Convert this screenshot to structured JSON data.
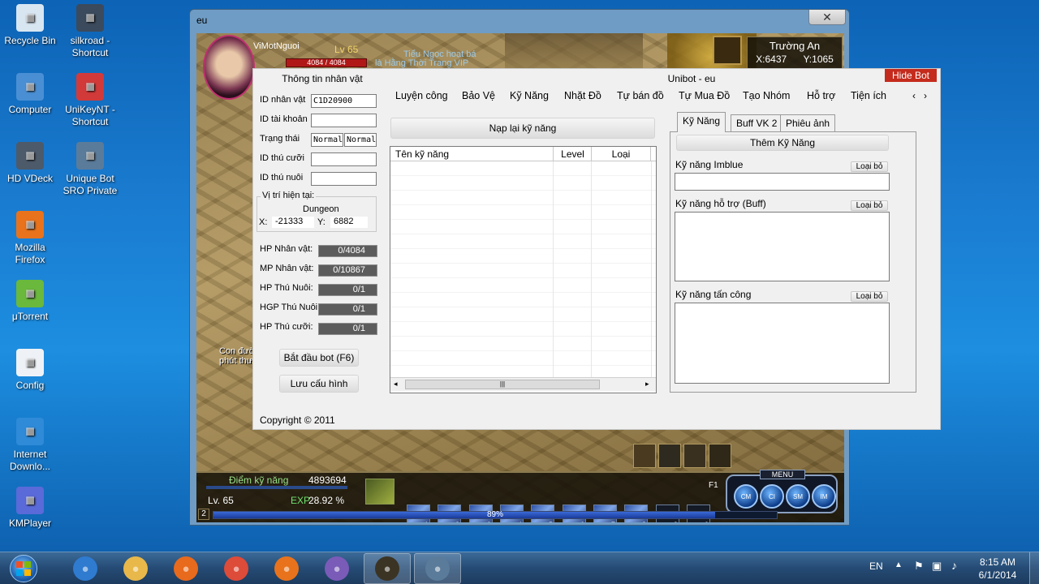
{
  "desktop": {
    "icons": [
      {
        "label": "Recycle Bin",
        "icon": "recycle-bin-icon",
        "color": "#d8e6f2"
      },
      {
        "label": "silkroad - Shortcut",
        "icon": "silkroad-icon",
        "color": "#3b4a5c"
      },
      {
        "label": "Computer",
        "icon": "computer-icon",
        "color": "#4a8fd4"
      },
      {
        "label": "UniKeyNT - Shortcut",
        "icon": "unikey-icon",
        "color": "#d23a3a"
      },
      {
        "label": "HD VDeck",
        "icon": "hd-vdeck-icon",
        "color": "#4d5a6a"
      },
      {
        "label": "Unique Bot SRO Private",
        "icon": "unique-bot-icon",
        "color": "#5b7b9a"
      },
      {
        "label": "Mozilla Firefox",
        "icon": "firefox-icon",
        "color": "#e8731c"
      },
      {
        "label": "μTorrent",
        "icon": "utorrent-icon",
        "color": "#6ab83c"
      },
      {
        "label": "Config",
        "icon": "config-icon",
        "color": "#eef2f6"
      },
      {
        "label": "Internet Downlo...",
        "icon": "idm-icon",
        "color": "#2f8ad8"
      },
      {
        "label": "KMPlayer",
        "icon": "kmplayer-icon",
        "color": "#5a6ad8"
      }
    ]
  },
  "game_window": {
    "title": "eu",
    "close_label": "✕",
    "character_name": "ViMotNguoi",
    "level": "Lv 65",
    "hp": "4084 / 4084",
    "banner_1": "Tiểu Ngọc hoạt bá",
    "banner_2": "là Hằng Thời Trang VIP",
    "location_title": "Trường An",
    "coord_x": "X:6437",
    "coord_y": "Y:1065",
    "chat_text": "Con đườ có k con cổ g khắc thư đượ những giờ phút thư giãn tuyệt vời!",
    "skill_points_label": "Điểm kỹ năng",
    "skill_points_value": "4893694",
    "level_bottom": "Lv. 65",
    "exp_label": "EXP",
    "exp_value": "28.92 %",
    "hud_progress_text": "89%",
    "hud_progress": 0.89,
    "menu_label": "MENU",
    "page_num": "2",
    "f1": "F1",
    "skill_slots": [
      "1",
      "2",
      "3",
      "4",
      "5",
      "6",
      "7",
      "8",
      "9",
      "0"
    ],
    "orbs": [
      "CM",
      "CI",
      "SM",
      "IM"
    ]
  },
  "bot": {
    "title": "Unibot - eu",
    "hide_label": "Hide Bot",
    "char_info_title": "Thông tin nhân vật",
    "fields": [
      {
        "label": "ID nhân vật",
        "value": "C1D20900"
      },
      {
        "label": "ID tài khoản",
        "value": ""
      },
      {
        "label": "Trạng thái",
        "value": "Normal",
        "value2": "Normal"
      },
      {
        "label": "ID thú cưỡi",
        "value": ""
      },
      {
        "label": "ID thú nuôi",
        "value": ""
      }
    ],
    "position": {
      "legend": "Vị trí hiện tại:",
      "area": "Dungeon",
      "x_label": "X:",
      "x": "-21333",
      "y_label": "Y:",
      "y": "6882"
    },
    "stats": [
      {
        "label": "HP Nhân vật:",
        "value": "0/4084"
      },
      {
        "label": "MP Nhân vật:",
        "value": "0/10867"
      },
      {
        "label": "HP Thú Nuôi:",
        "value": "0/1"
      },
      {
        "label": "HGP Thú Nuôi:",
        "value": "0/1"
      },
      {
        "label": "HP Thú cưỡi:",
        "value": "0/1"
      }
    ],
    "start_label": "Bắt đầu bot (F6)",
    "save_label": "Lưu cấu hình",
    "copyright": "Copyright © 2011",
    "tabs": [
      "Luyện công",
      "Bảo Vệ",
      "Kỹ Năng",
      "Nhặt Đồ",
      "Tự bán đồ",
      "Tự Mua Đồ",
      "Tạo Nhóm",
      "Hỗ trợ",
      "Tiện ích"
    ],
    "reload_label": "Nạp lại kỹ năng",
    "skill_table": {
      "columns": [
        "Tên kỹ năng",
        "Level",
        "Loại"
      ],
      "rows": []
    },
    "right_tabs": [
      "Kỹ Năng",
      "Buff VK 2",
      "Phiêu ảnh"
    ],
    "add_skill_label": "Thêm Kỹ Năng",
    "imblue_label": "Kỹ năng Imblue",
    "buff_label": "Kỹ năng hỗ trợ (Buff)",
    "attack_label": "Kỹ năng tấn công",
    "remove_label": "Loại bỏ"
  },
  "taskbar": {
    "start_icon": "windows-start-icon",
    "apps": [
      {
        "icon": "internet-explorer-icon",
        "color": "#2f7bd0"
      },
      {
        "icon": "file-explorer-icon",
        "color": "#e8b84a"
      },
      {
        "icon": "media-player-icon",
        "color": "#e86a1c"
      },
      {
        "icon": "chrome-icon",
        "color": "#dd4b39"
      },
      {
        "icon": "firefox-icon",
        "color": "#e8731c"
      },
      {
        "icon": "visual-studio-icon",
        "color": "#7a5bb8"
      },
      {
        "icon": "silkroad-icon",
        "color": "#3b3424"
      },
      {
        "icon": "unique-bot-icon",
        "color": "#5b7b9a"
      }
    ],
    "language": "EN",
    "time": "8:15 AM",
    "date": "6/1/2014"
  }
}
